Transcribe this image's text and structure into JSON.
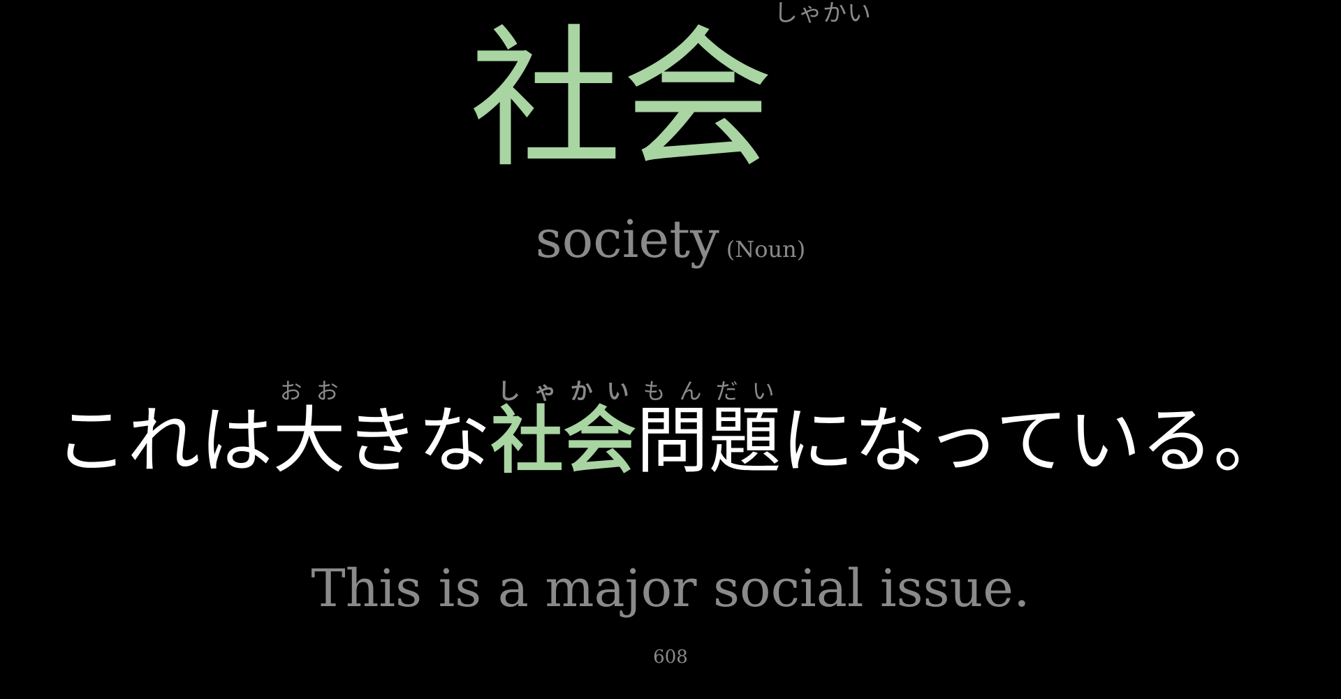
{
  "card": {
    "word": {
      "kanji": "社会",
      "reading": "しゃかい"
    },
    "meaning": "society",
    "part_of_speech": "(Noun)",
    "sentence": {
      "segments": [
        {
          "text": "これは",
          "ruby": ""
        },
        {
          "text": "大",
          "ruby": "おお"
        },
        {
          "text": "きな",
          "ruby": ""
        },
        {
          "text": "社会",
          "ruby": "しゃかい"
        },
        {
          "text": "問題",
          "ruby": "もんだい"
        },
        {
          "text": "になっている。",
          "ruby": ""
        }
      ]
    },
    "translation": "This is a major social issue.",
    "counter": "608"
  },
  "colors": {
    "background": "#000000",
    "accent": "#a8d5a2",
    "muted": "#8a8a8a",
    "text": "#ffffff"
  }
}
